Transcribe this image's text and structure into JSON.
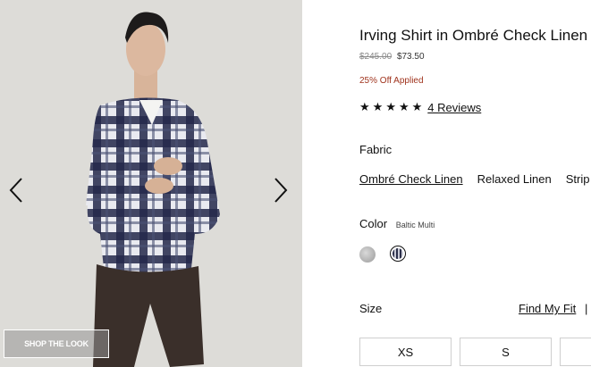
{
  "gallery": {
    "shop_the_look_label": "SHOP THE LOOK",
    "prev_icon": "chevron-left-icon",
    "next_icon": "chevron-right-icon"
  },
  "product": {
    "title": "Irving Shirt in Ombré Check Linen",
    "original_price": "$245.00",
    "sale_price": "$73.50",
    "discount_text": "25% Off Applied",
    "rating": 5,
    "star_icon": "star-icon",
    "reviews_link": "4 Reviews"
  },
  "fabric": {
    "label": "Fabric",
    "options": [
      {
        "label": "Ombré Check Linen",
        "selected": true
      },
      {
        "label": "Relaxed Linen",
        "selected": false
      },
      {
        "label": "Strip",
        "selected": false
      }
    ]
  },
  "color": {
    "label": "Color",
    "value": "Baltic Multi",
    "swatches": [
      "grey-swatch",
      "baltic-multi-swatch"
    ]
  },
  "size": {
    "label": "Size",
    "find_fit_link": "Find My Fit",
    "separator": "|",
    "options": [
      "XS",
      "S"
    ]
  },
  "colors": {
    "discount": "#a0341e",
    "shirt_dark": "#2b2f4a",
    "shorts": "#3a2f2a"
  }
}
